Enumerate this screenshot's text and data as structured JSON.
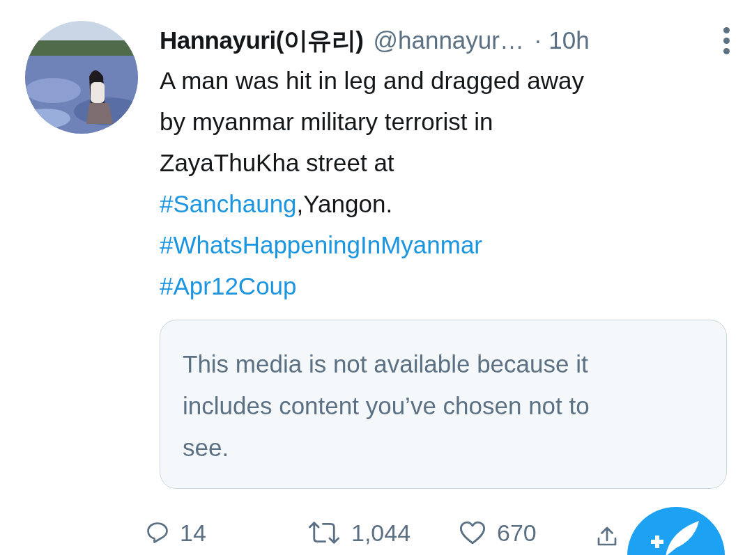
{
  "tweet": {
    "name": "Hannayuri(이유리)",
    "handle": "@hannayur…",
    "time": "· 10h",
    "avatar": {
      "kind": "picture"
    },
    "lines": [
      [
        {
          "kind": "text",
          "text": "A man was hit in leg and dragged away"
        }
      ],
      [
        {
          "kind": "text",
          "text": "by myanmar military terrorist in"
        }
      ],
      [
        {
          "kind": "text",
          "text": "ZayaThuKha street at"
        }
      ],
      [
        {
          "kind": "hashtag",
          "text": "#Sanchaung"
        },
        {
          "kind": "text",
          "text": ",Yangon."
        }
      ],
      [
        {
          "kind": "hashtag",
          "text": "#WhatsHappeningInMyanmar"
        }
      ],
      [
        {
          "kind": "hashtag",
          "text": "#Apr12Coup"
        }
      ]
    ],
    "media_notice": "This media is not available because it includes content you’ve chosen not to see.",
    "actions": [
      {
        "kind": "reply",
        "count": "14"
      },
      {
        "kind": "retweet",
        "count": "1,044"
      },
      {
        "kind": "like",
        "count": "670"
      },
      {
        "kind": "share"
      }
    ]
  }
}
